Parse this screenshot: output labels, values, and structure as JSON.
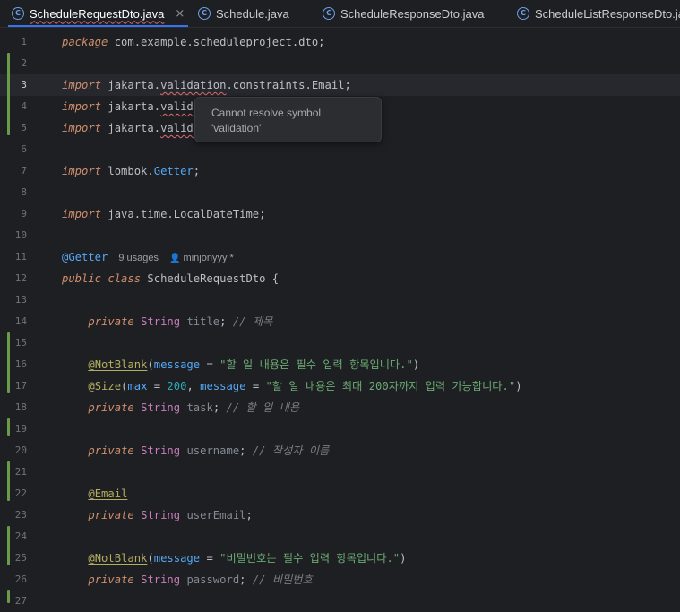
{
  "tabs": [
    {
      "label": "ScheduleRequestDto.java",
      "active": true,
      "icon": "class-c-icon",
      "close": "×"
    },
    {
      "label": "Schedule.java",
      "active": false,
      "icon": "class-c-icon"
    },
    {
      "label": "ScheduleResponseDto.java",
      "active": false,
      "icon": "class-c-icon"
    },
    {
      "label": "ScheduleListResponseDto.java",
      "active": false,
      "icon": "class-c-icon"
    }
  ],
  "editor": {
    "current_line": 3,
    "line_numbers": [
      "1",
      "2",
      "3",
      "4",
      "5",
      "6",
      "7",
      "8",
      "9",
      "10",
      "11",
      "12",
      "13",
      "14",
      "15",
      "16",
      "17",
      "18",
      "19",
      "20",
      "21",
      "22",
      "23",
      "24",
      "25",
      "26",
      "27"
    ],
    "lines": {
      "l1": {
        "kw": "package",
        "rest": " com.example.scheduleproject.dto;"
      },
      "l3": {
        "kw": "import",
        "a": " jakarta.",
        "b": "validation",
        "c": ".constraints.Email;"
      },
      "l4": {
        "kw": "import",
        "a": " jakarta.",
        "b": "valida"
      },
      "l5": {
        "kw": "import",
        "a": " jakarta.",
        "b": "valida"
      },
      "l7": {
        "kw": "import",
        "a": " lombok.",
        "b": "Getter",
        ";": ";"
      },
      "l9": {
        "kw": "import",
        "a": " java.time.LocalDateTime;"
      },
      "l11": {
        "ann": "@Getter",
        "usages": "9 usages",
        "author": "minjonyyy *"
      },
      "l12": {
        "kw1": "public",
        "kw2": "class",
        "rest": " ScheduleRequestDto {"
      },
      "l14": {
        "kw": "private",
        "ty": "String",
        "field": "title",
        "cmt": "// 제목"
      },
      "l16": {
        "ann": "@NotBlank",
        "param": "message",
        "str": "\"할 일 내용은 필수 입력 항목입니다.\""
      },
      "l17": {
        "ann": "@Size",
        "p1": "max",
        "num": "200",
        "p2": "message",
        "str": "\"할 일 내용은 최대 200자까지 입력 가능합니다.\""
      },
      "l18": {
        "kw": "private",
        "ty": "String",
        "field": "task",
        "cmt": "// 할 일 내용"
      },
      "l20": {
        "kw": "private",
        "ty": "String",
        "field": "username",
        "cmt": "// 작성자 이름"
      },
      "l22": {
        "ann": "@Email"
      },
      "l23": {
        "kw": "private",
        "ty": "String",
        "field": "userEmail"
      },
      "l25": {
        "ann": "@NotBlank",
        "param": "message",
        "str": "\"비밀번호는 필수 입력 항목입니다.\""
      },
      "l26": {
        "kw": "private",
        "ty": "String",
        "field": "password",
        "cmt": "// 비밀번호"
      }
    }
  },
  "tooltip": {
    "line1": "Cannot resolve symbol",
    "line2": "'validation'"
  },
  "colors": {
    "accent": "#3574f0",
    "change_marker": "#6a9b48",
    "error": "#e06c6c",
    "background": "#1e1f22"
  }
}
